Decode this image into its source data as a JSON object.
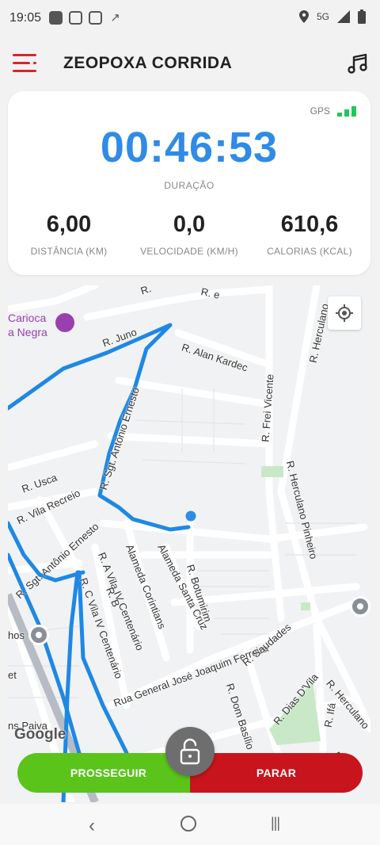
{
  "status_bar": {
    "time": "19:05",
    "network": "5G",
    "icons_left": [
      "app-icon",
      "instagram-icon",
      "instagram-icon",
      "running-icon"
    ],
    "icons_right": [
      "location-icon",
      "signal-icon",
      "battery-icon"
    ]
  },
  "app_bar": {
    "title": "ZEOPOXA CORRIDA",
    "menu_icon": "hamburger-menu-icon",
    "music_icon": "music-note-icon"
  },
  "stats": {
    "gps_label": "GPS",
    "gps_signal_bars": 3,
    "duration_value": "00:46:53",
    "duration_label": "DURAÇÃO",
    "distance_value": "6,00",
    "distance_label": "DISTÂNCIA (KM)",
    "speed_value": "0,0",
    "speed_label": "VELOCIDADE (KM/H)",
    "calories_value": "610,6",
    "calories_label": "CALORIAS (KCAL)"
  },
  "map": {
    "poi_label_line1": "Carioca",
    "poi_label_line2": "a Negra",
    "streets": {
      "juno": "R. Juno",
      "alan_kardec": "R. Alan Kardec",
      "sgt_antonio_ernesto_upper": "R. Sgt. Antônio Ernesto",
      "frei_vicente": "R. Frei Vicente",
      "herculano": "R. Herculano",
      "herculano_pinheiro": "R. Herculano Pinheiro",
      "usca": "R. Usca",
      "vila_recreio": "R. Vila Recreio",
      "sgt_antonio_ernesto_lower": "R. Sgt. Antônio Ernesto",
      "a_vila_iv_centenario": "R. A Vila IV Centenário",
      "b": "R. B",
      "c_vila_iv_centenario": "R. C Vila IV Centenário",
      "alameda_corintians": "Alameda Corintians",
      "alameda_santa_cruz": "Alameda Santa Cruz",
      "botumirim": "R. Botumirim",
      "general_jose_joaquim_ferreira": "Rua General José Joaquim Ferreira",
      "saudades": "R. Saudades",
      "dom_basilio": "R. Dom Basílio",
      "dias_dvila": "R. Dias D'Vila",
      "ifa": "R. Ifá",
      "herculano_lower": "R. Herculano",
      "top_partial_r": "R.",
      "top_partial_e": "R. e",
      "rua_partial": "Rua G",
      "left_hos": "hos",
      "left_et": "et",
      "left_paiva": "ns Paiva"
    },
    "attribution": "Google"
  },
  "controls": {
    "continue_label": "PROSSEGUIR",
    "stop_label": "PARAR",
    "lock_icon": "unlock-icon"
  },
  "colors": {
    "accent_blue": "#2f8be6",
    "continue_green": "#5ac41a",
    "stop_red": "#c8151d",
    "menu_red": "#d7262c",
    "gps_green": "#22c55e",
    "route_blue": "#1e88e5"
  }
}
